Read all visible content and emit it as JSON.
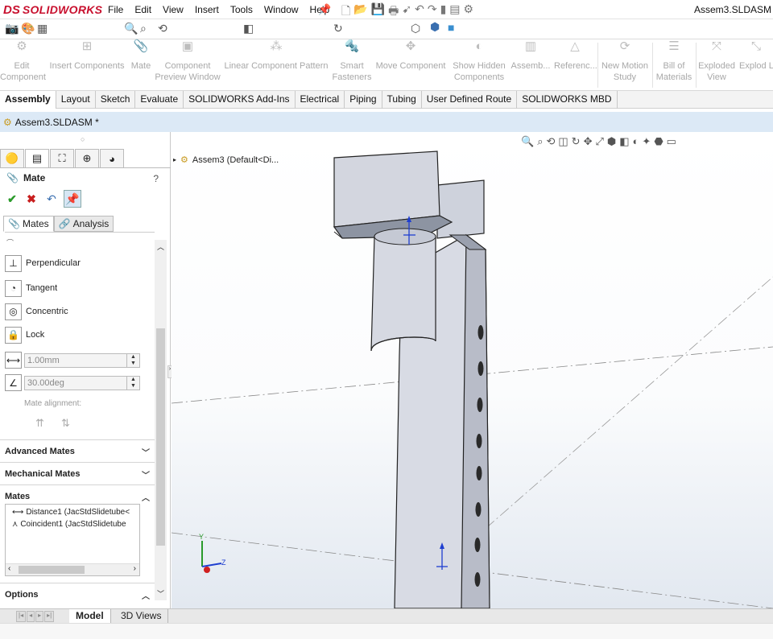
{
  "app": {
    "brand": "SOLIDWORKS",
    "brand_prefix": "DS",
    "doc_title": "Assem3.SLDASM"
  },
  "menu": [
    "File",
    "Edit",
    "View",
    "Insert",
    "Tools",
    "Window",
    "Help"
  ],
  "commands": [
    {
      "label": "Edit Component"
    },
    {
      "label": "Insert Components"
    },
    {
      "label": "Mate"
    },
    {
      "label": "Component Preview Window"
    },
    {
      "label": "Linear Component Pattern"
    },
    {
      "label": "Smart Fasteners"
    },
    {
      "label": "Move Component"
    },
    {
      "label": "Show Hidden Components"
    },
    {
      "label": "Assemb..."
    },
    {
      "label": "Referenc..."
    },
    {
      "label": "New Motion Study"
    },
    {
      "label": "Bill of Materials"
    },
    {
      "label": "Exploded View"
    },
    {
      "label": "Explod Line Ske"
    }
  ],
  "tabs": [
    "Assembly",
    "Layout",
    "Sketch",
    "Evaluate",
    "SOLIDWORKS Add-Ins",
    "Electrical",
    "Piping",
    "Tubing",
    "User Defined Route",
    "SOLIDWORKS MBD"
  ],
  "doc_tab": "Assem3.SLDASM *",
  "panel": {
    "header": "Mate",
    "subtabs": [
      "Mates",
      "Analysis"
    ],
    "mate_types": [
      "Perpendicular",
      "Tangent",
      "Concentric",
      "Lock"
    ],
    "distance_value": "1.00mm",
    "angle_value": "30.00deg",
    "alignment_label": "Mate alignment:",
    "sections": [
      "Advanced Mates",
      "Mechanical Mates",
      "Mates",
      "Options"
    ],
    "mates_list": [
      "Distance1 (JacStdSlidetube<",
      "Coincident1 (JacStdSlidetube"
    ]
  },
  "tree": {
    "root": "Assem3  (Default<Di..."
  },
  "bottom_tabs": [
    "Model",
    "3D Views"
  ],
  "colors": {
    "accent": "#c8102e",
    "tab_active_bg": "#ffffff",
    "doc_bar": "#dce9f6"
  }
}
